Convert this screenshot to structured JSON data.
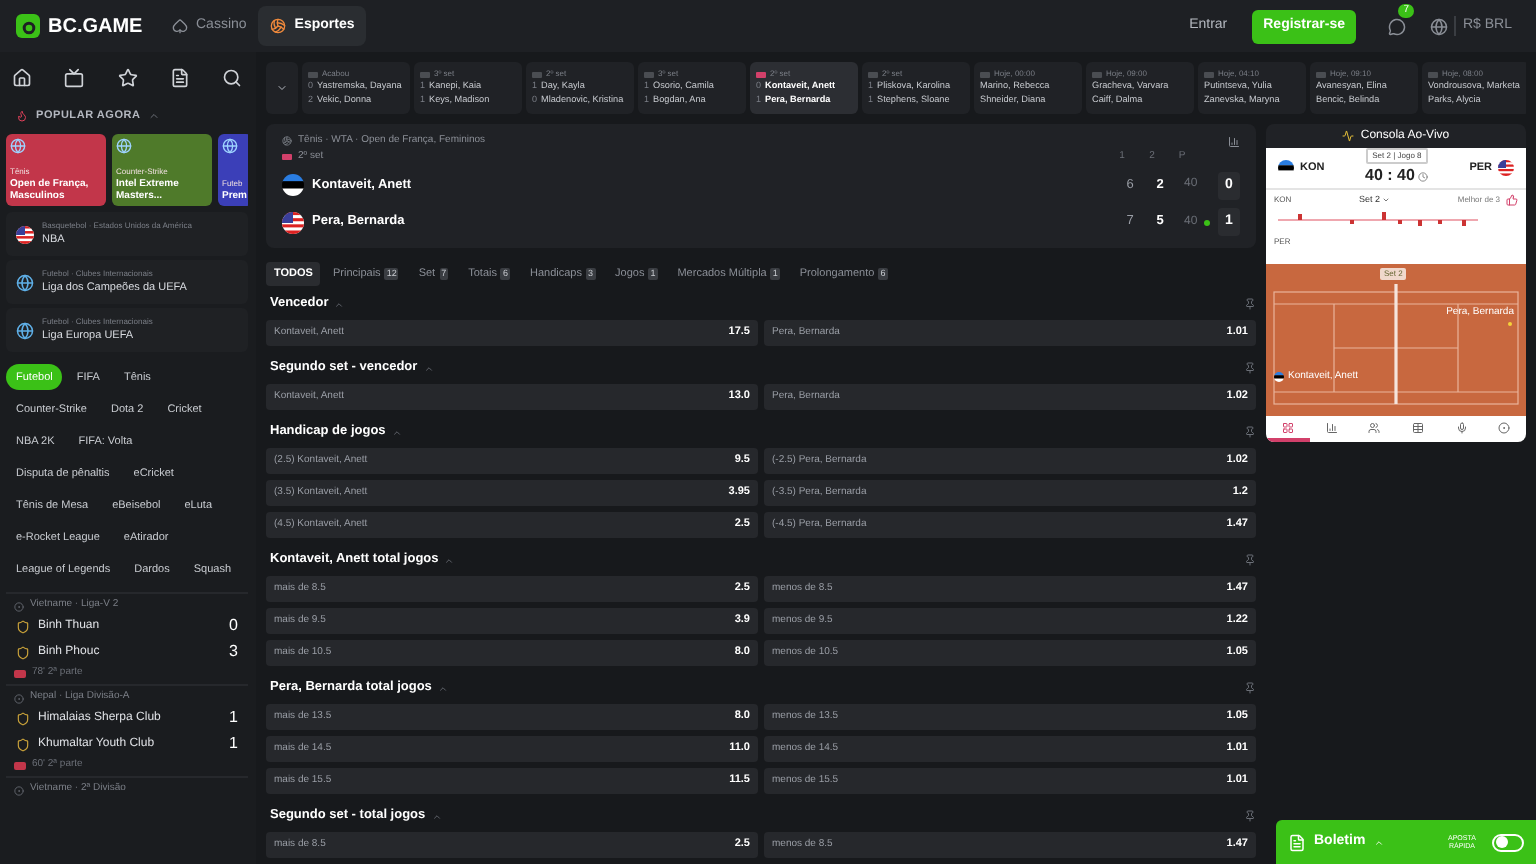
{
  "header": {
    "logo": "BC.GAME",
    "nav": [
      {
        "label": "Cassino",
        "selected": false
      },
      {
        "label": "Esportes",
        "selected": true
      }
    ],
    "login": "Entrar",
    "register": "Registrar-se",
    "chat_badge": "7",
    "currency": "R$ BRL"
  },
  "sidebar": {
    "popular_title": "POPULAR AGORA",
    "popular": [
      {
        "category": "Tênis",
        "title": "Open de França, Masculinos",
        "color": "#c2364a"
      },
      {
        "category": "Counter-Strike",
        "title": "Intel Extreme Masters...",
        "color": "#4f7a2a"
      },
      {
        "category": "Futeb",
        "title": "Prem",
        "color": "#3b3fb8"
      }
    ],
    "leagues": [
      {
        "category": "Basquetebol · Estados Unidos da América",
        "name": "NBA"
      },
      {
        "category": "Futebol · Clubes Internacionais",
        "name": "Liga dos Campeões da UEFA"
      },
      {
        "category": "Futebol · Clubes Internacionais",
        "name": "Liga Europa UEFA"
      }
    ],
    "sports": [
      {
        "label": "Futebol",
        "selected": true
      },
      {
        "label": "FIFA",
        "selected": false
      },
      {
        "label": "Tênis",
        "selected": false
      },
      {
        "label": "Counter-Strike",
        "selected": false
      },
      {
        "label": "Dota 2",
        "selected": false
      },
      {
        "label": "Cricket",
        "selected": false
      },
      {
        "label": "NBA 2K",
        "selected": false
      },
      {
        "label": "FIFA: Volta",
        "selected": false
      },
      {
        "label": "Disputa de pênaltis",
        "selected": false
      },
      {
        "label": "eCricket",
        "selected": false
      },
      {
        "label": "Tênis de Mesa",
        "selected": false
      },
      {
        "label": "eBeisebol",
        "selected": false
      },
      {
        "label": "eLuta",
        "selected": false
      },
      {
        "label": "e-Rocket League",
        "selected": false
      },
      {
        "label": "eAtirador",
        "selected": false
      },
      {
        "label": "League of Legends",
        "selected": false
      },
      {
        "label": "Dardos",
        "selected": false
      },
      {
        "label": "Squash",
        "selected": false
      }
    ],
    "matches": [
      {
        "league": "Vietname · Liga-V 2",
        "teams": [
          {
            "name": "Binh Thuan",
            "score": "0"
          },
          {
            "name": "Binh Phouc",
            "score": "3"
          }
        ],
        "time": "78' 2ª parte"
      },
      {
        "league": "Nepal · Liga Divisão-A",
        "teams": [
          {
            "name": "Himalaias Sherpa Club",
            "score": "1"
          },
          {
            "name": "Khumaltar Youth Club",
            "score": "1"
          }
        ],
        "time": "60' 2ª parte"
      },
      {
        "league": "Vietname · 2ª Divisão"
      }
    ]
  },
  "strip": [
    {
      "status": "Acabou",
      "live": false,
      "selected": false,
      "teams": [
        {
          "score": "0",
          "name": "Yastremska, Dayana"
        },
        {
          "score": "2",
          "name": "Vekic, Donna"
        }
      ]
    },
    {
      "status": "3º set",
      "live": false,
      "selected": false,
      "teams": [
        {
          "score": "1",
          "name": "Kanepi, Kaia"
        },
        {
          "score": "1",
          "name": "Keys, Madison"
        }
      ]
    },
    {
      "status": "2º set",
      "live": false,
      "selected": false,
      "teams": [
        {
          "score": "1",
          "name": "Day, Kayla"
        },
        {
          "score": "0",
          "name": "Mladenovic, Kristina"
        }
      ]
    },
    {
      "status": "3º set",
      "live": false,
      "selected": false,
      "teams": [
        {
          "score": "1",
          "name": "Osorio, Camila"
        },
        {
          "score": "1",
          "name": "Bogdan, Ana"
        }
      ]
    },
    {
      "status": "2º set",
      "live": true,
      "selected": true,
      "teams": [
        {
          "score": "0",
          "name": "Kontaveit, Anett"
        },
        {
          "score": "1",
          "name": "Pera, Bernarda"
        }
      ]
    },
    {
      "status": "2º set",
      "live": false,
      "selected": false,
      "teams": [
        {
          "score": "1",
          "name": "Pliskova, Karolina"
        },
        {
          "score": "1",
          "name": "Stephens, Sloane"
        }
      ]
    },
    {
      "status": "Hoje, 00:00",
      "live": false,
      "selected": false,
      "teams": [
        {
          "name": "Marino, Rebecca"
        },
        {
          "name": "Shneider, Diana"
        }
      ]
    },
    {
      "status": "Hoje, 09:00",
      "live": false,
      "selected": false,
      "teams": [
        {
          "name": "Gracheva, Varvara"
        },
        {
          "name": "Caiff, Dalma"
        }
      ]
    },
    {
      "status": "Hoje, 04:10",
      "live": false,
      "selected": false,
      "teams": [
        {
          "name": "Putintseva, Yulia"
        },
        {
          "name": "Zanevska, Maryna"
        }
      ]
    },
    {
      "status": "Hoje, 09:10",
      "live": false,
      "selected": false,
      "teams": [
        {
          "name": "Avanesyan, Elina"
        },
        {
          "name": "Bencic, Belinda"
        }
      ]
    },
    {
      "status": "Hoje, 08:00",
      "live": false,
      "selected": false,
      "teams": [
        {
          "name": "Vondrousova, Marketa"
        },
        {
          "name": "Parks, Alycia"
        }
      ]
    }
  ],
  "match": {
    "breadcrumb": "Tênis · WTA · Open de França, Femininos",
    "status": "2º set",
    "score_headers": [
      "1",
      "2",
      "P"
    ],
    "players": [
      {
        "name": "Kontaveit, Anett",
        "sets": [
          "6",
          "2"
        ],
        "points": "40",
        "serving": false,
        "total": "0"
      },
      {
        "name": "Pera, Bernarda",
        "sets": [
          "7",
          "5"
        ],
        "points": "40",
        "serving": true,
        "total": "1"
      }
    ]
  },
  "market_tabs": [
    {
      "label": "TODOS",
      "selected": true
    },
    {
      "label": "Principais",
      "count": "12",
      "selected": false
    },
    {
      "label": "Set",
      "count": "7",
      "selected": false
    },
    {
      "label": "Totais",
      "count": "6",
      "selected": false
    },
    {
      "label": "Handicaps",
      "count": "3",
      "selected": false
    },
    {
      "label": "Jogos",
      "count": "1",
      "selected": false
    },
    {
      "label": "Mercados Múltipla",
      "count": "1",
      "selected": false
    },
    {
      "label": "Prolongamento",
      "count": "6",
      "selected": false
    }
  ],
  "markets": [
    {
      "title": "Vencedor",
      "rows": [
        [
          {
            "label": "Kontaveit, Anett",
            "odd": "17.5"
          },
          {
            "label": "Pera, Bernarda",
            "odd": "1.01"
          }
        ]
      ]
    },
    {
      "title": "Segundo set - vencedor",
      "rows": [
        [
          {
            "label": "Kontaveit, Anett",
            "odd": "13.0"
          },
          {
            "label": "Pera, Bernarda",
            "odd": "1.02"
          }
        ]
      ]
    },
    {
      "title": "Handicap de jogos",
      "rows": [
        [
          {
            "label": "(2.5) Kontaveit, Anett",
            "odd": "9.5"
          },
          {
            "label": "(-2.5) Pera, Bernarda",
            "odd": "1.02"
          }
        ],
        [
          {
            "label": "(3.5) Kontaveit, Anett",
            "odd": "3.95"
          },
          {
            "label": "(-3.5) Pera, Bernarda",
            "odd": "1.2"
          }
        ],
        [
          {
            "label": "(4.5) Kontaveit, Anett",
            "odd": "2.5"
          },
          {
            "label": "(-4.5) Pera, Bernarda",
            "odd": "1.47"
          }
        ]
      ]
    },
    {
      "title": "Kontaveit, Anett total jogos",
      "rows": [
        [
          {
            "label": "mais de 8.5",
            "odd": "2.5"
          },
          {
            "label": "menos de 8.5",
            "odd": "1.47"
          }
        ],
        [
          {
            "label": "mais de 9.5",
            "odd": "3.9"
          },
          {
            "label": "menos de 9.5",
            "odd": "1.22"
          }
        ],
        [
          {
            "label": "mais de 10.5",
            "odd": "8.0"
          },
          {
            "label": "menos de 10.5",
            "odd": "1.05"
          }
        ]
      ]
    },
    {
      "title": "Pera, Bernarda total jogos",
      "rows": [
        [
          {
            "label": "mais de 13.5",
            "odd": "8.0"
          },
          {
            "label": "menos de 13.5",
            "odd": "1.05"
          }
        ],
        [
          {
            "label": "mais de 14.5",
            "odd": "11.0"
          },
          {
            "label": "menos de 14.5",
            "odd": "1.01"
          }
        ],
        [
          {
            "label": "mais de 15.5",
            "odd": "11.5"
          },
          {
            "label": "menos de 15.5",
            "odd": "1.01"
          }
        ]
      ]
    },
    {
      "title": "Segundo set - total jogos",
      "rows": [
        [
          {
            "label": "mais de 8.5",
            "odd": "2.5"
          },
          {
            "label": "menos de 8.5",
            "odd": "1.47"
          }
        ]
      ]
    }
  ],
  "console": {
    "title": "Consola Ao-Vivo",
    "home": "KON",
    "away": "PER",
    "info": "Set 2 | Jogo 8",
    "score": "40 : 40",
    "graph_home": "KON",
    "graph_away": "PER",
    "set_select": "Set 2",
    "best_of": "Melhor de 3",
    "court_label": "Set 2",
    "court_players": [
      "Pera, Bernarda",
      "Kontaveit, Anett"
    ],
    "tabs": [
      {
        "selected": true
      },
      {
        "selected": false
      },
      {
        "selected": false
      },
      {
        "selected": false
      },
      {
        "selected": false
      },
      {
        "selected": false
      }
    ]
  },
  "betslip": {
    "title": "Boletim",
    "quick_bet": "APOSTA RÁPIDA",
    "quick_on": false
  }
}
